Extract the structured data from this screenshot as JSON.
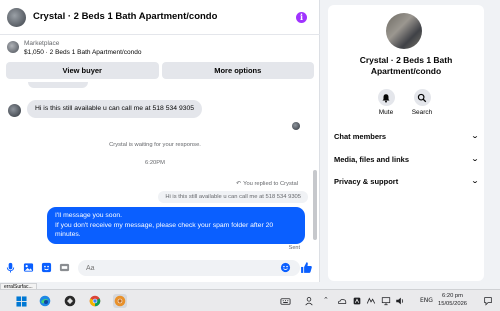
{
  "header": {
    "title": "Crystal · 2 Beds 1 Bath Apartment/condo",
    "info_icon": "i"
  },
  "listing": {
    "label": "Marketplace",
    "price_title": "$1,050 · 2 Beds 1 Bath Apartment/condo"
  },
  "actions": {
    "view_buyer": "View buyer",
    "more_options": "More options"
  },
  "messages": {
    "incoming": "Hi is this still available u can call me at 518 534 9305",
    "waiting": "Crystal is waiting for your response.",
    "time": "6:20PM",
    "replied_to": "You replied to Crystal",
    "replied_arrow": "↶",
    "quoted": "Hi is this still available u can call me at 518 534 9305",
    "outgoing": [
      "I'll message you soon.",
      "If you don't receive my message, please check your spam folder after 20",
      "minutes."
    ],
    "status": "Sent"
  },
  "composer": {
    "placeholder": "Aa",
    "icons": [
      "microphone-icon",
      "image-icon",
      "sticker-icon",
      "gif-icon",
      "emoji-icon",
      "thumbs-up-icon"
    ]
  },
  "info_panel": {
    "title": "Crystal · 2 Beds 1 Bath Apartment/condo",
    "mute": "Mute",
    "search": "Search",
    "sections": [
      "Chat members",
      "Media, files and links",
      "Privacy & support"
    ],
    "chevron": "⌄"
  },
  "taskbar": {
    "cutoff_label": "erralSurfac...",
    "language": "ENG",
    "time": "6:20 pm",
    "date": "15/05/2026"
  },
  "colors": {
    "accent_blue": "#0a5fff",
    "info_purple": "#a033ff",
    "bubble_gray": "#e4e6eb"
  }
}
